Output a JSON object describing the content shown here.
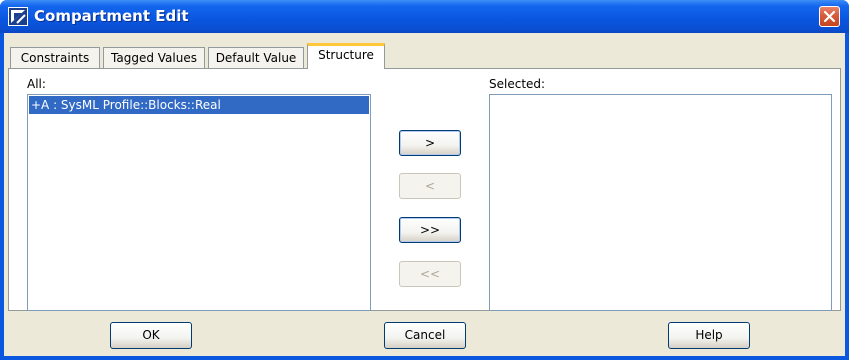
{
  "window": {
    "title": "Compartment Edit",
    "accent_color": "#0a58e0",
    "icon": "app-icon",
    "close_icon": "close-icon"
  },
  "tabs": [
    {
      "label": "Constraints",
      "active": false
    },
    {
      "label": "Tagged Values",
      "active": false
    },
    {
      "label": "Default Value",
      "active": false
    },
    {
      "label": "Structure",
      "active": true
    }
  ],
  "structure": {
    "all_label": "All:",
    "selected_label": "Selected:",
    "all_items": [
      "+A : SysML Profile::Blocks::Real"
    ],
    "selected_items": [],
    "selection_color": "#316ac5"
  },
  "transfer_buttons": {
    "add": ">",
    "remove": "<",
    "add_all": ">>",
    "remove_all": "<<"
  },
  "footer": {
    "ok": "OK",
    "cancel": "Cancel",
    "help": "Help"
  }
}
